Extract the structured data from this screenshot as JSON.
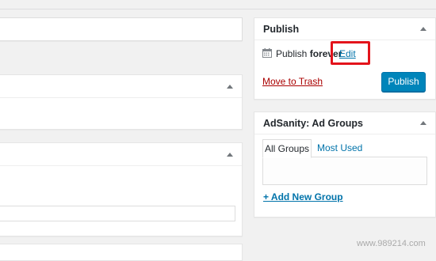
{
  "publish_box": {
    "title": "Publish",
    "status_prefix": "Publish ",
    "status_value": "forever",
    "edit_link": "Edit",
    "trash_link": "Move to Trash",
    "publish_button": "Publish"
  },
  "adsanity_box": {
    "title": "AdSanity: Ad Groups",
    "tabs": [
      {
        "label": "All Groups",
        "active": true
      },
      {
        "label": "Most Used",
        "active": false
      }
    ],
    "add_new_link": "+ Add New Group"
  },
  "watermark": "www.989214.com",
  "colors": {
    "accent": "#0073aa",
    "primary_button": "#0085ba",
    "trash": "#aa0000",
    "highlight": "#e3131b"
  },
  "icons": [
    "calendar-icon",
    "collapse-arrow-icon"
  ]
}
